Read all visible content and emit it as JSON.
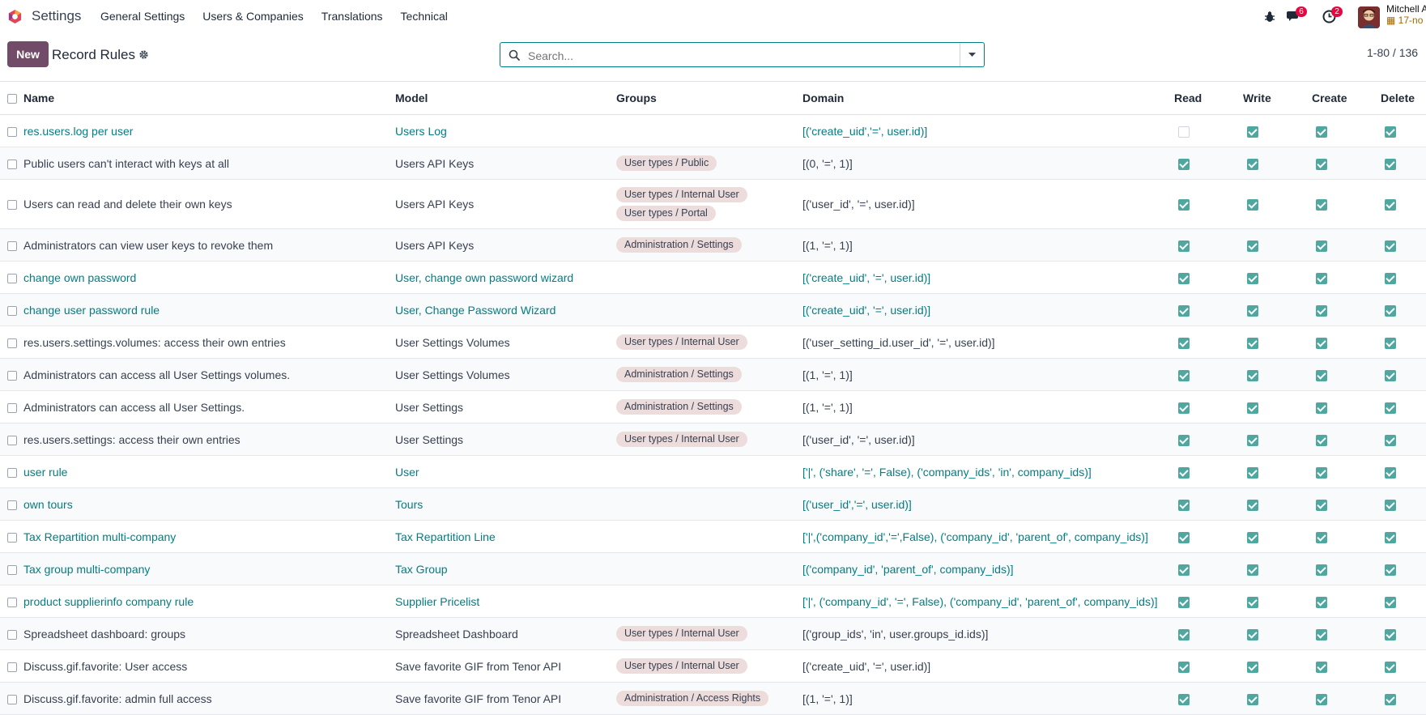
{
  "app": {
    "name": "Settings"
  },
  "nav": {
    "items": [
      "General Settings",
      "Users & Companies",
      "Translations",
      "Technical"
    ]
  },
  "systray": {
    "messages_badge": "6",
    "activity_badge": "2",
    "user_name": "Mitchell A",
    "database": "17-no"
  },
  "control": {
    "new_label": "New",
    "breadcrumb": "Record Rules",
    "search_placeholder": "Search...",
    "pager": "1-80 / 136"
  },
  "table": {
    "headers": [
      "Name",
      "Model",
      "Groups",
      "Domain",
      "Read",
      "Write",
      "Create",
      "Delete"
    ],
    "rows": [
      {
        "name": "res.users.log per user",
        "model": "Users Log",
        "groups": [],
        "domain": "[('create_uid','=', user.id)]",
        "link": true,
        "perms": [
          false,
          true,
          true,
          true
        ]
      },
      {
        "name": "Public users can't interact with keys at all",
        "model": "Users API Keys",
        "groups": [
          "User types / Public"
        ],
        "domain": "[(0, '=', 1)]",
        "link": false,
        "perms": [
          true,
          true,
          true,
          true
        ]
      },
      {
        "name": "Users can read and delete their own keys",
        "model": "Users API Keys",
        "groups": [
          "User types / Internal User",
          "User types / Portal"
        ],
        "domain": "[('user_id', '=', user.id)]",
        "link": false,
        "perms": [
          true,
          true,
          true,
          true
        ]
      },
      {
        "name": "Administrators can view user keys to revoke them",
        "model": "Users API Keys",
        "groups": [
          "Administration / Settings"
        ],
        "domain": "[(1, '=', 1)]",
        "link": false,
        "perms": [
          true,
          true,
          true,
          true
        ]
      },
      {
        "name": "change own password",
        "model": "User, change own password wizard",
        "groups": [],
        "domain": "[('create_uid', '=', user.id)]",
        "link": true,
        "perms": [
          true,
          true,
          true,
          true
        ]
      },
      {
        "name": "change user password rule",
        "model": "User, Change Password Wizard",
        "groups": [],
        "domain": "[('create_uid', '=', user.id)]",
        "link": true,
        "perms": [
          true,
          true,
          true,
          true
        ]
      },
      {
        "name": "res.users.settings.volumes: access their own entries",
        "model": "User Settings Volumes",
        "groups": [
          "User types / Internal User"
        ],
        "domain": "[('user_setting_id.user_id', '=', user.id)]",
        "link": false,
        "perms": [
          true,
          true,
          true,
          true
        ]
      },
      {
        "name": "Administrators can access all User Settings volumes.",
        "model": "User Settings Volumes",
        "groups": [
          "Administration / Settings"
        ],
        "domain": "[(1, '=', 1)]",
        "link": false,
        "perms": [
          true,
          true,
          true,
          true
        ]
      },
      {
        "name": "Administrators can access all User Settings.",
        "model": "User Settings",
        "groups": [
          "Administration / Settings"
        ],
        "domain": "[(1, '=', 1)]",
        "link": false,
        "perms": [
          true,
          true,
          true,
          true
        ]
      },
      {
        "name": "res.users.settings: access their own entries",
        "model": "User Settings",
        "groups": [
          "User types / Internal User"
        ],
        "domain": "[('user_id', '=', user.id)]",
        "link": false,
        "perms": [
          true,
          true,
          true,
          true
        ]
      },
      {
        "name": "user rule",
        "model": "User",
        "groups": [],
        "domain": "['|', ('share', '=', False), ('company_ids', 'in', company_ids)]",
        "link": true,
        "perms": [
          true,
          true,
          true,
          true
        ]
      },
      {
        "name": "own tours",
        "model": "Tours",
        "groups": [],
        "domain": "[('user_id','=', user.id)]",
        "link": true,
        "perms": [
          true,
          true,
          true,
          true
        ]
      },
      {
        "name": "Tax Repartition multi-company",
        "model": "Tax Repartition Line",
        "groups": [],
        "domain": "['|',('company_id','=',False), ('company_id', 'parent_of', company_ids)]",
        "link": true,
        "perms": [
          true,
          true,
          true,
          true
        ]
      },
      {
        "name": "Tax group multi-company",
        "model": "Tax Group",
        "groups": [],
        "domain": "[('company_id', 'parent_of', company_ids)]",
        "link": true,
        "perms": [
          true,
          true,
          true,
          true
        ]
      },
      {
        "name": "product supplierinfo company rule",
        "model": "Supplier Pricelist",
        "groups": [],
        "domain": "['|', ('company_id', '=', False), ('company_id', 'parent_of', company_ids)]",
        "link": true,
        "perms": [
          true,
          true,
          true,
          true
        ]
      },
      {
        "name": "Spreadsheet dashboard: groups",
        "model": "Spreadsheet Dashboard",
        "groups": [
          "User types / Internal User"
        ],
        "domain": "[('group_ids', 'in', user.groups_id.ids)]",
        "link": false,
        "perms": [
          true,
          true,
          true,
          true
        ]
      },
      {
        "name": "Discuss.gif.favorite: User access",
        "model": "Save favorite GIF from Tenor API",
        "groups": [
          "User types / Internal User"
        ],
        "domain": "[('create_uid', '=', user.id)]",
        "link": false,
        "perms": [
          true,
          true,
          true,
          true
        ]
      },
      {
        "name": "Discuss.gif.favorite: admin full access",
        "model": "Save favorite GIF from Tenor API",
        "groups": [
          "Administration / Access Rights"
        ],
        "domain": "[(1, '=', 1)]",
        "link": false,
        "perms": [
          true,
          true,
          true,
          true
        ]
      }
    ]
  }
}
